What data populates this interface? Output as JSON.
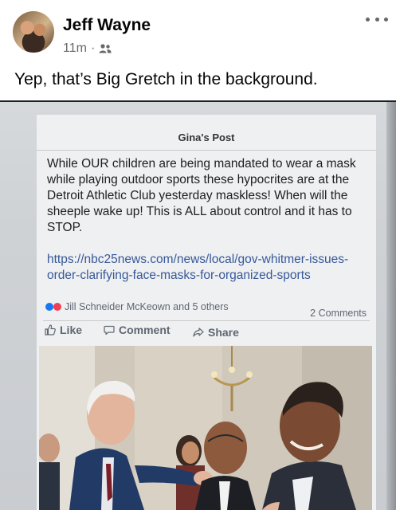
{
  "post": {
    "author": "Jeff Wayne",
    "time": "11m",
    "separator": "·",
    "audience_icon": "friends-icon",
    "more_icon": "more-horizontal-icon",
    "caption": "Yep, that’s Big Gretch in the background."
  },
  "shared_post": {
    "title": "Gina's Post",
    "text": "While OUR children are being mandated to wear a mask while playing outdoor sports these hypocrites are at the Detroit Athletic Club yesterday maskless! When will the sheeple wake up! This is ALL about control and it has to STOP.",
    "link": "https://nbc25news.com/news/local/gov-whitmer-issues-order-clarifying-face-masks-for-organized-sports",
    "reactions_text": "Jill Schneider McKeown and 5 others",
    "comments_text": "2 Comments",
    "actions": {
      "like": "Like",
      "comment": "Comment",
      "share": "Share"
    }
  },
  "colors": {
    "link": "#385898",
    "meta": "#65676b",
    "like_blue": "#1877f2",
    "love_red": "#f33e58"
  }
}
